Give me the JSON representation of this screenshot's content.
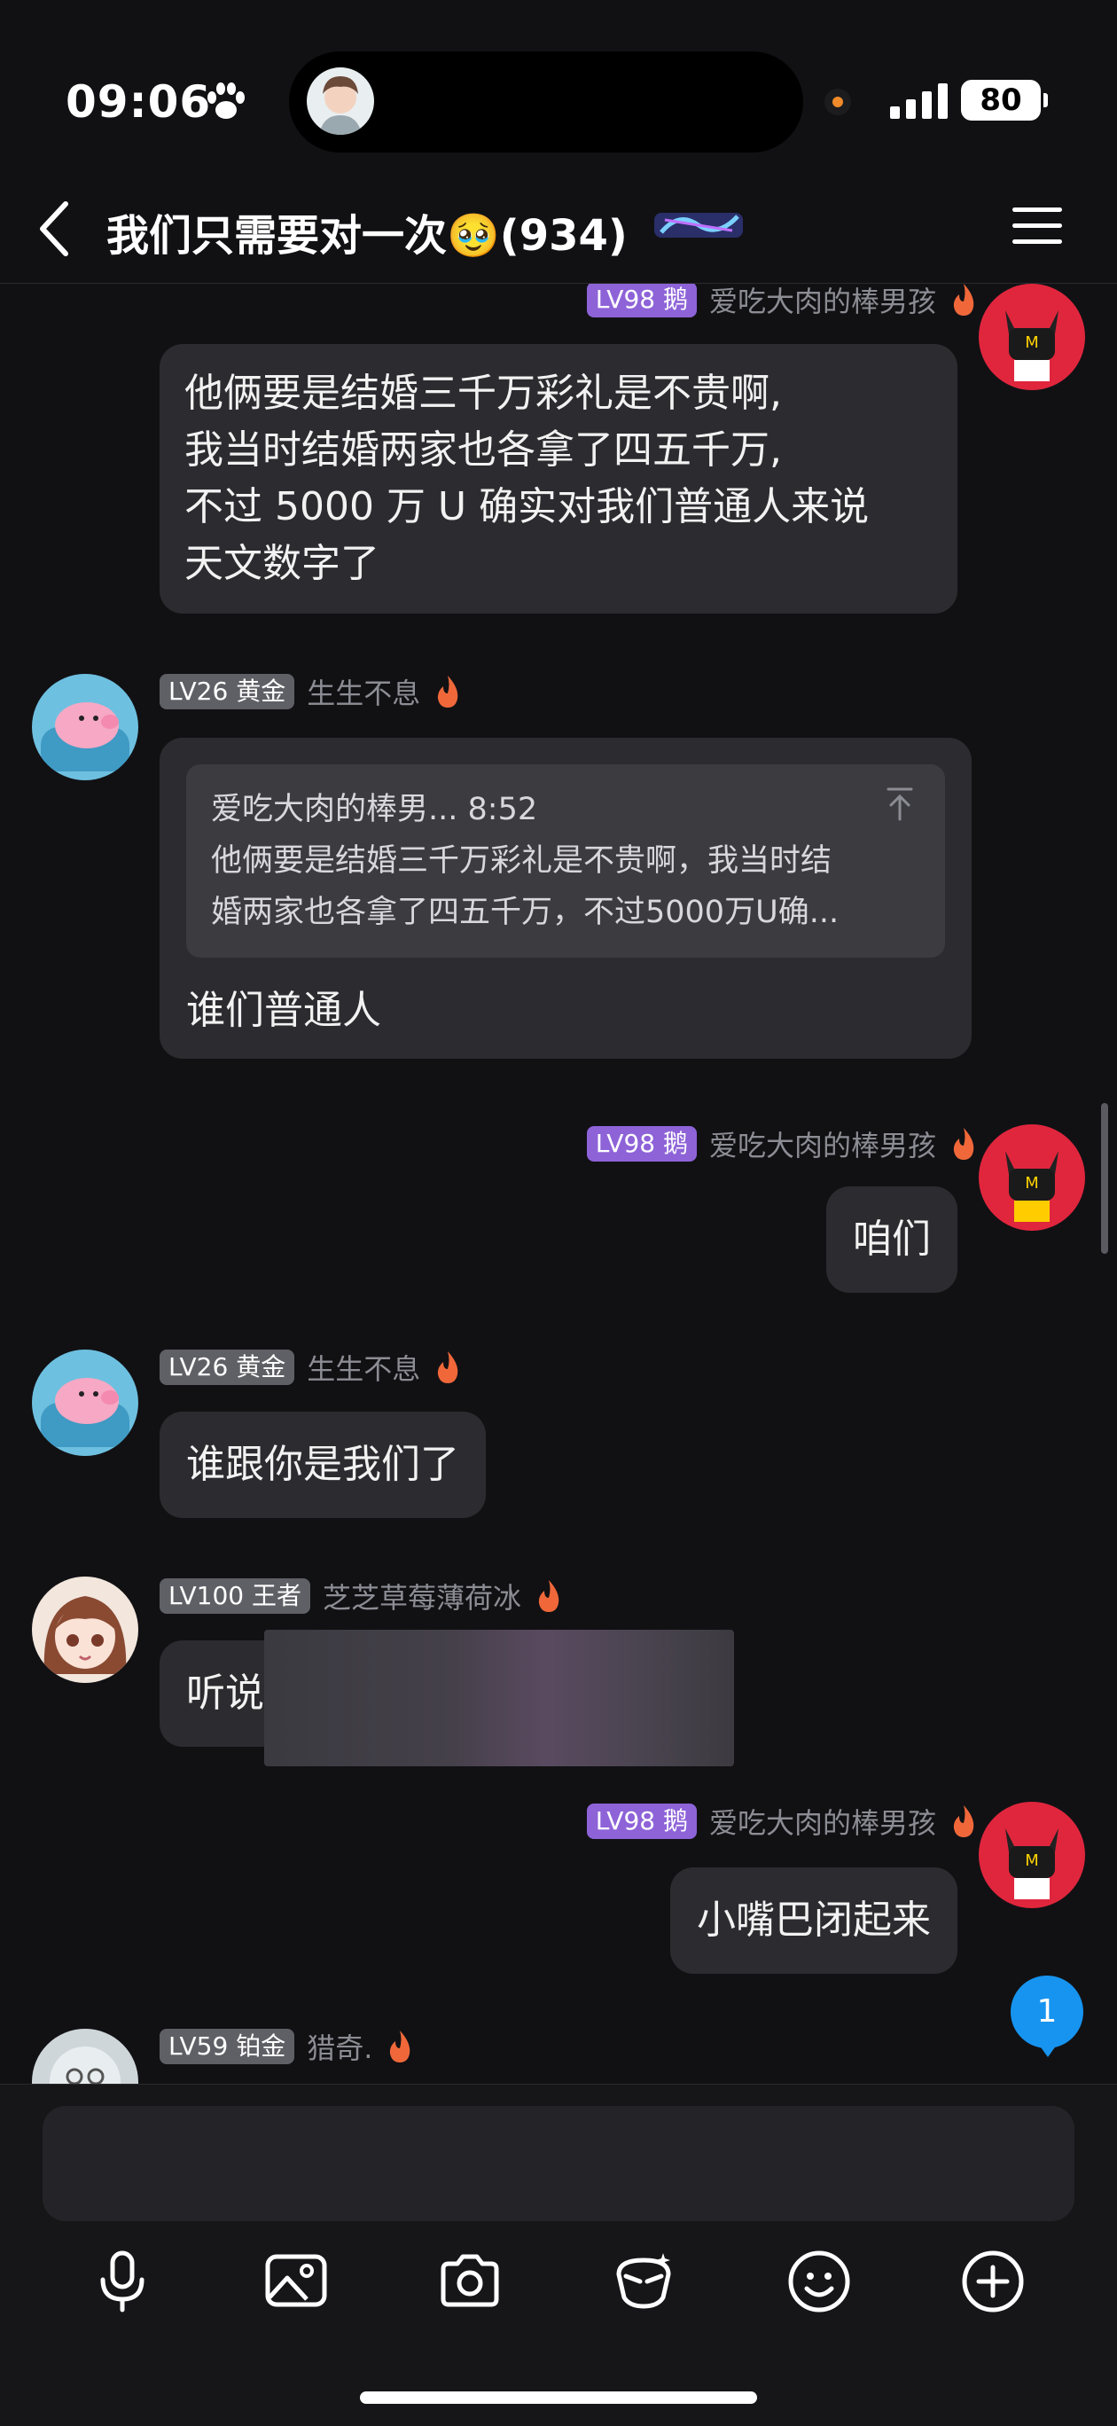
{
  "status": {
    "time": "09:06",
    "battery": "80"
  },
  "header": {
    "title": "我们只需要对一次🥹(934)"
  },
  "messages": [
    {
      "side": "right",
      "level": "LV98 鹅",
      "nick": "爱吃大肉的棒男孩",
      "lines": [
        "他俩要是结婚三千万彩礼是不贵啊,",
        "我当时结婚两家也各拿了四五千万,",
        "不过 5000 万 U 确实对我们普通人来说",
        "天文数字了"
      ]
    },
    {
      "side": "left",
      "level": "LV26 黄金",
      "nick": "生生不息",
      "quote": {
        "head": "爱吃大肉的棒男... 8:52",
        "lines": [
          "他俩要是结婚三千万彩礼是不贵啊，我当时结",
          "婚两家也各拿了四五千万，不过5000万U确..."
        ]
      },
      "text": "谁们普通人"
    },
    {
      "side": "right",
      "level": "LV98 鹅",
      "nick": "爱吃大肉的棒男孩",
      "text": "咱们"
    },
    {
      "side": "left",
      "level": "LV26 黄金",
      "nick": "生生不息",
      "text": "谁跟你是我们了"
    },
    {
      "side": "left",
      "level": "LV100 王者",
      "nick": "芝芝草莓薄荷冰",
      "text": "听说"
    },
    {
      "side": "right",
      "level": "LV98 鹅",
      "nick": "爱吃大肉的棒男孩",
      "text": "小嘴巴闭起来"
    },
    {
      "side": "left",
      "level": "LV59 铂金",
      "nick": "猎奇."
    }
  ],
  "unread_count": "1",
  "colors": {
    "bg": "#111114",
    "bubble": "#2c2c30",
    "lv_purple": "#8e63d8",
    "lv_gray": "#5f5f66",
    "unread": "#1794f0"
  },
  "toolbar": [
    "microphone-icon",
    "image-icon",
    "camera-icon",
    "sticker-icon",
    "emoji-icon",
    "plus-icon"
  ]
}
